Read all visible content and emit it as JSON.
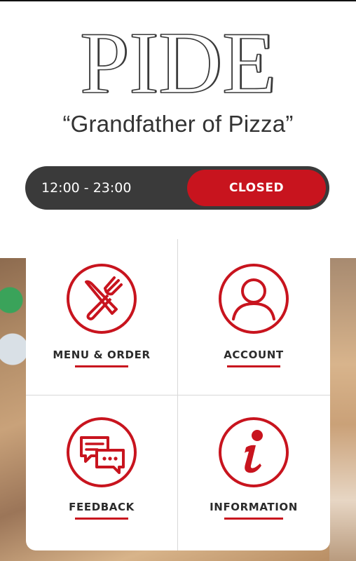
{
  "brand": {
    "name": "PIDE",
    "tagline": "“Grandfather of Pizza”"
  },
  "hours": {
    "range": "12:00 - 23:00",
    "status": "CLOSED"
  },
  "tiles": [
    {
      "label": "MENU & ORDER",
      "icon": "cutlery-icon"
    },
    {
      "label": "ACCOUNT",
      "icon": "user-icon"
    },
    {
      "label": "FEEDBACK",
      "icon": "chat-bubbles-icon"
    },
    {
      "label": "INFORMATION",
      "icon": "info-icon"
    }
  ],
  "colors": {
    "accent": "#c8141e",
    "hours_bar": "#3a3a3a",
    "text": "#2b2b2b"
  }
}
